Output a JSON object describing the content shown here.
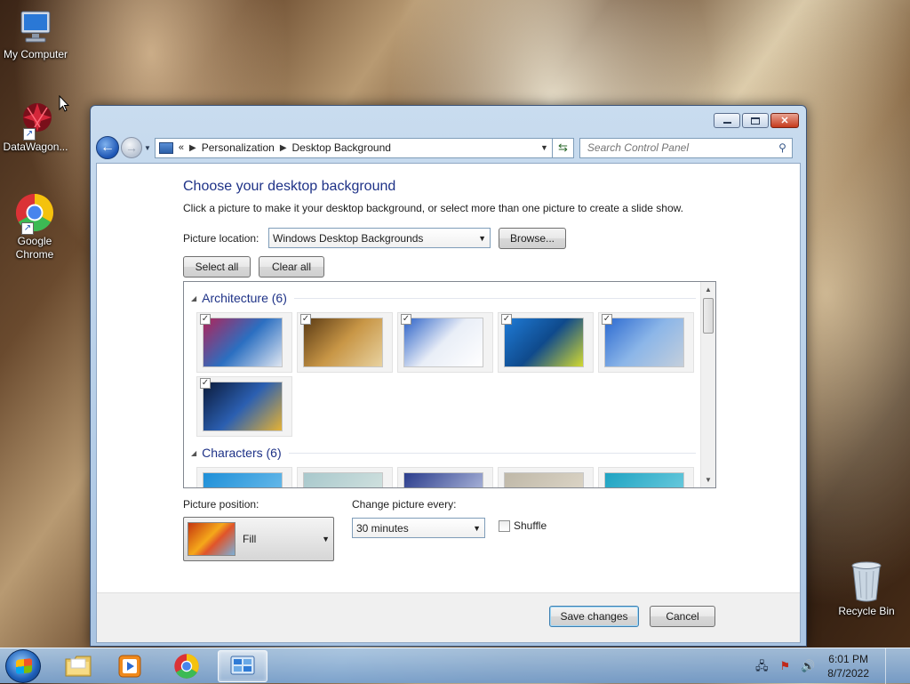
{
  "desktop": {
    "icons": [
      {
        "label": "My Computer"
      },
      {
        "label": "DataWagon..."
      },
      {
        "label": "Google Chrome"
      },
      {
        "label": "Recycle Bin"
      }
    ]
  },
  "window": {
    "nav": {
      "breadcrumb": [
        "Personalization",
        "Desktop Background"
      ],
      "search_placeholder": "Search Control Panel"
    },
    "title": "Choose your desktop background",
    "description": "Click a picture to make it your desktop background, or select more than one picture to create a slide show.",
    "picture_location_label": "Picture location:",
    "picture_location_value": "Windows Desktop Backgrounds",
    "browse_label": "Browse...",
    "select_all_label": "Select all",
    "clear_all_label": "Clear all",
    "groups": [
      {
        "name": "Architecture (6)",
        "thumbs": [
          {
            "checked": true,
            "colors": [
              "#b0245a",
              "#2b6fc1",
              "#dfe6f1"
            ]
          },
          {
            "checked": true,
            "colors": [
              "#5a3a14",
              "#c89646",
              "#e8d2a0"
            ]
          },
          {
            "checked": true,
            "colors": [
              "#2d63c8",
              "#e9eef7",
              "#ffffff"
            ]
          },
          {
            "checked": true,
            "colors": [
              "#1f7bd6",
              "#0f4a8c",
              "#d2d930"
            ]
          },
          {
            "checked": true,
            "colors": [
              "#2c6ad1",
              "#8cb6e8",
              "#c4cfdc"
            ]
          },
          {
            "checked": true,
            "colors": [
              "#0b1a3a",
              "#2b5fb1",
              "#e5b234"
            ]
          }
        ]
      },
      {
        "name": "Characters (6)",
        "thumbs": [
          {
            "checked": false,
            "colors": [
              "#1e8fd8",
              "#7cc6ef"
            ]
          },
          {
            "checked": false,
            "colors": [
              "#a8c8cc",
              "#dce8e4"
            ]
          },
          {
            "checked": false,
            "colors": [
              "#2a3c8c",
              "#d0d8f0"
            ]
          },
          {
            "checked": false,
            "colors": [
              "#bfb8a8",
              "#e4ddcf"
            ]
          },
          {
            "checked": false,
            "colors": [
              "#1ea3c2",
              "#7fd5e5"
            ]
          }
        ]
      }
    ],
    "picture_position_label": "Picture position:",
    "picture_position_value": "Fill",
    "change_every_label": "Change picture every:",
    "change_every_value": "30 minutes",
    "shuffle_label": "Shuffle",
    "shuffle_checked": false,
    "save_label": "Save changes",
    "cancel_label": "Cancel"
  },
  "taskbar": {
    "apps": [
      {
        "name": "Windows Explorer",
        "icon": "folder-icon"
      },
      {
        "name": "Windows Media Player",
        "icon": "media-player-icon"
      },
      {
        "name": "Google Chrome",
        "icon": "chrome-icon"
      },
      {
        "name": "Control Panel",
        "icon": "control-panel-icon",
        "active": true
      }
    ],
    "clock_time": "6:01 PM",
    "clock_date": "8/7/2022"
  }
}
